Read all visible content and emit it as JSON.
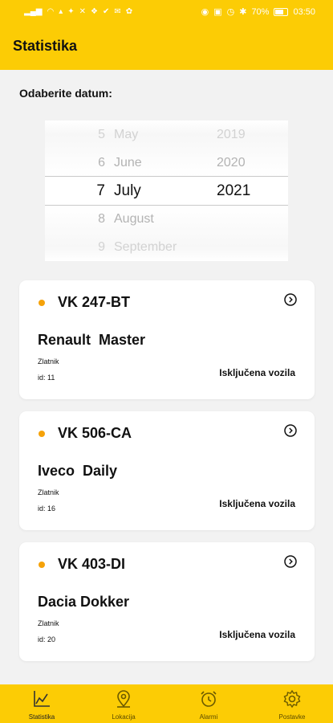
{
  "status_bar": {
    "battery": "70%",
    "time": "03:50",
    "left_icons": [
      "signal-icon",
      "wifi-icon",
      "speed-icon",
      "app-icon",
      "app-icon",
      "twitter-icon",
      "check-icon",
      "mail-icon",
      "app-icon"
    ],
    "right_icons": [
      "eye-icon",
      "nfc-icon",
      "alarm-icon",
      "bluetooth-icon"
    ]
  },
  "header": {
    "title": "Statistika"
  },
  "date_picker": {
    "label": "Odaberite datum:",
    "rows": [
      {
        "day": "5",
        "month": "May",
        "year": "2019"
      },
      {
        "day": "6",
        "month": "June",
        "year": "2020"
      },
      {
        "day": "7",
        "month": "July",
        "year": "2021"
      },
      {
        "day": "8",
        "month": "August",
        "year": ""
      },
      {
        "day": "9",
        "month": "September",
        "year": ""
      }
    ]
  },
  "vehicles": [
    {
      "plate": "VK 247-BT",
      "model": "Renault  Master",
      "owner": "Zlatnik",
      "id": "id: 11",
      "status": "Isključena vozila"
    },
    {
      "plate": "VK 506-CA",
      "model": "Iveco  Daily",
      "owner": "Zlatnik",
      "id": "id: 16",
      "status": "Isključena vozila"
    },
    {
      "plate": "VK 403-DI",
      "model": "Dacia Dokker",
      "owner": "Zlatnik",
      "id": "id: 20",
      "status": "Isključena vozila"
    }
  ],
  "bottom_nav": {
    "items": [
      {
        "label": "Statistika",
        "icon": "chart-icon",
        "active": true
      },
      {
        "label": "Lokacija",
        "icon": "location-pin-icon",
        "active": false
      },
      {
        "label": "Alarmi",
        "icon": "alarm-clock-icon",
        "active": false
      },
      {
        "label": "Postavke",
        "icon": "gear-icon",
        "active": false
      }
    ]
  },
  "colors": {
    "accent": "#fccc05",
    "status_dot": "#f5a20a",
    "background": "#f2f2f2"
  }
}
